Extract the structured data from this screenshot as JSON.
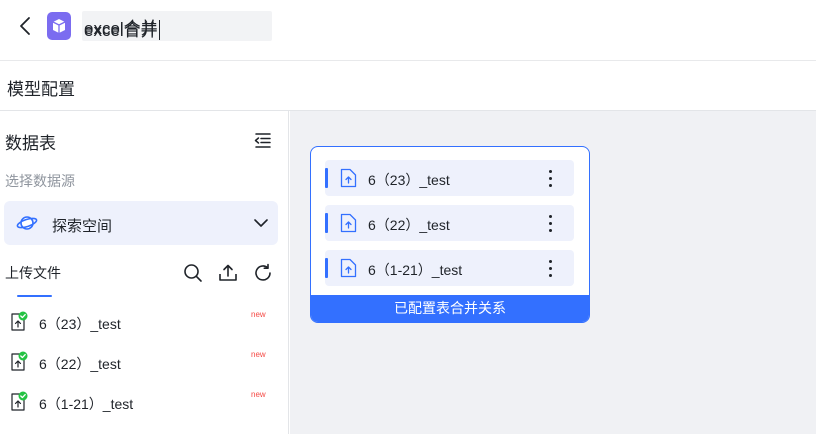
{
  "header": {
    "title_value": "excel合并",
    "icons": {
      "back": "chevron-left-icon",
      "app": "cube-icon"
    }
  },
  "subheader": {
    "title": "模型配置"
  },
  "sidebar": {
    "title": "数据表",
    "hint": "选择数据源",
    "space": {
      "label": "探索空间",
      "icon": "planet-icon"
    },
    "tab": {
      "label": "上传文件"
    },
    "tools": [
      "search-icon",
      "upload-icon",
      "refresh-icon"
    ],
    "files": [
      {
        "name": "6（23）_test",
        "badge": "new"
      },
      {
        "name": "6（22）_test",
        "badge": "new"
      },
      {
        "name": "6（1-21）_test",
        "badge": "new"
      }
    ]
  },
  "canvas": {
    "card": {
      "rows": [
        {
          "name": "6（23）_test"
        },
        {
          "name": "6（22）_test"
        },
        {
          "name": "6（1-21）_test"
        }
      ],
      "footer": "已配置表合并关系"
    }
  },
  "colors": {
    "accent": "#3370ff",
    "app_icon": "#7b6cf0",
    "badge": "#f54a45",
    "success": "#23c343"
  }
}
